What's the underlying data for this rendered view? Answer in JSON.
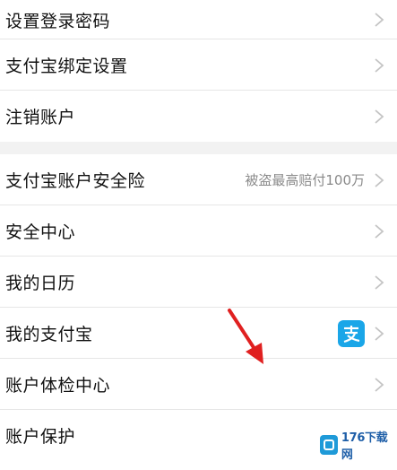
{
  "group1": {
    "items": [
      {
        "label": "设置登录密码"
      },
      {
        "label": "支付宝绑定设置"
      },
      {
        "label": "注销账户"
      }
    ]
  },
  "group2": {
    "items": [
      {
        "label": "支付宝账户安全险",
        "value": "被盗最高赔付100万"
      },
      {
        "label": "安全中心"
      },
      {
        "label": "我的日历"
      },
      {
        "label": "我的支付宝",
        "icon": "alipay-icon"
      },
      {
        "label": "账户体检中心"
      },
      {
        "label": "账户保护"
      }
    ]
  },
  "colors": {
    "alipay_blue": "#1aa6e8",
    "annotation_arrow": "#e02020",
    "divider": "#e6e6e6",
    "section_gap": "#f2f2f2"
  },
  "watermark": {
    "text": "176下载网"
  }
}
